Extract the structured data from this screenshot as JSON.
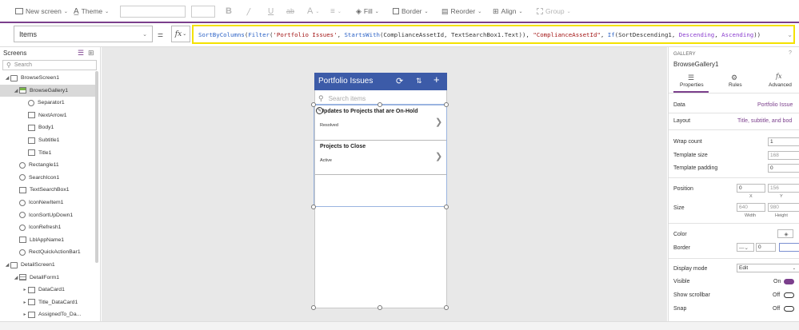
{
  "toolbar": {
    "new_screen": "New screen",
    "theme": "Theme",
    "fill": "Fill",
    "border": "Border",
    "reorder": "Reorder",
    "align": "Align",
    "group": "Group"
  },
  "formula_bar": {
    "property": "Items",
    "equals": "=",
    "fx": "fx",
    "formula": "SortByColumns(Filter('Portfolio Issues', StartsWith(ComplianceAssetId, TextSearchBox1.Text)), \"ComplianceAssetId\", If(SortDescending1, Descending, Ascending))"
  },
  "tree": {
    "header": "Screens",
    "search_placeholder": "Search",
    "items": [
      {
        "label": "BrowseScreen1"
      },
      {
        "label": "BrowseGallery1"
      },
      {
        "label": "Separator1"
      },
      {
        "label": "NextArrow1"
      },
      {
        "label": "Body1"
      },
      {
        "label": "Subtitle1"
      },
      {
        "label": "Title1"
      },
      {
        "label": "Rectangle11"
      },
      {
        "label": "SearchIcon1"
      },
      {
        "label": "TextSearchBox1"
      },
      {
        "label": "IconNewItem1"
      },
      {
        "label": "IconSortUpDown1"
      },
      {
        "label": "IconRefresh1"
      },
      {
        "label": "LblAppName1"
      },
      {
        "label": "RectQuickActionBar1"
      },
      {
        "label": "DetailScreen1"
      },
      {
        "label": "DetailForm1"
      },
      {
        "label": "DataCard1"
      },
      {
        "label": "Title_DataCard1"
      },
      {
        "label": "AssignedTo_Da..."
      }
    ]
  },
  "app": {
    "title": "Portfolio Issues",
    "search_placeholder": "Search items",
    "rows": [
      {
        "title": "Updates to Projects that are On-Hold",
        "subtitle": "Resolved"
      },
      {
        "title": "Projects to Close",
        "subtitle": "Active"
      }
    ]
  },
  "properties": {
    "type": "GALLERY",
    "name": "BrowseGallery1",
    "tabs": [
      "Properties",
      "Rules",
      "Advanced"
    ],
    "data_label": "Data",
    "data_value": "Portfolio Issue",
    "layout_label": "Layout",
    "layout_value": "Title, subtitle, and bod",
    "wrap_count_label": "Wrap count",
    "wrap_count": "1",
    "template_size_label": "Template size",
    "template_size": "168",
    "template_padding_label": "Template padding",
    "template_padding": "0",
    "position_label": "Position",
    "pos_x": "0",
    "pos_y": "156",
    "x_label": "X",
    "y_label": "Y",
    "size_label": "Size",
    "width": "640",
    "height": "980",
    "width_label": "Width",
    "height_label": "Height",
    "color_label": "Color",
    "border_label": "Border",
    "border_width": "0",
    "display_mode_label": "Display mode",
    "display_mode": "Edit",
    "visible_label": "Visible",
    "visible_value": "On",
    "show_scrollbar_label": "Show scrollbar",
    "show_scrollbar_value": "Off",
    "snap_label": "Snap",
    "snap_value": "Off"
  },
  "colors": {
    "app_header": "#3c5ba8",
    "formula_highlight": "#f4e100",
    "accent_purple": "#7b3f8c"
  }
}
